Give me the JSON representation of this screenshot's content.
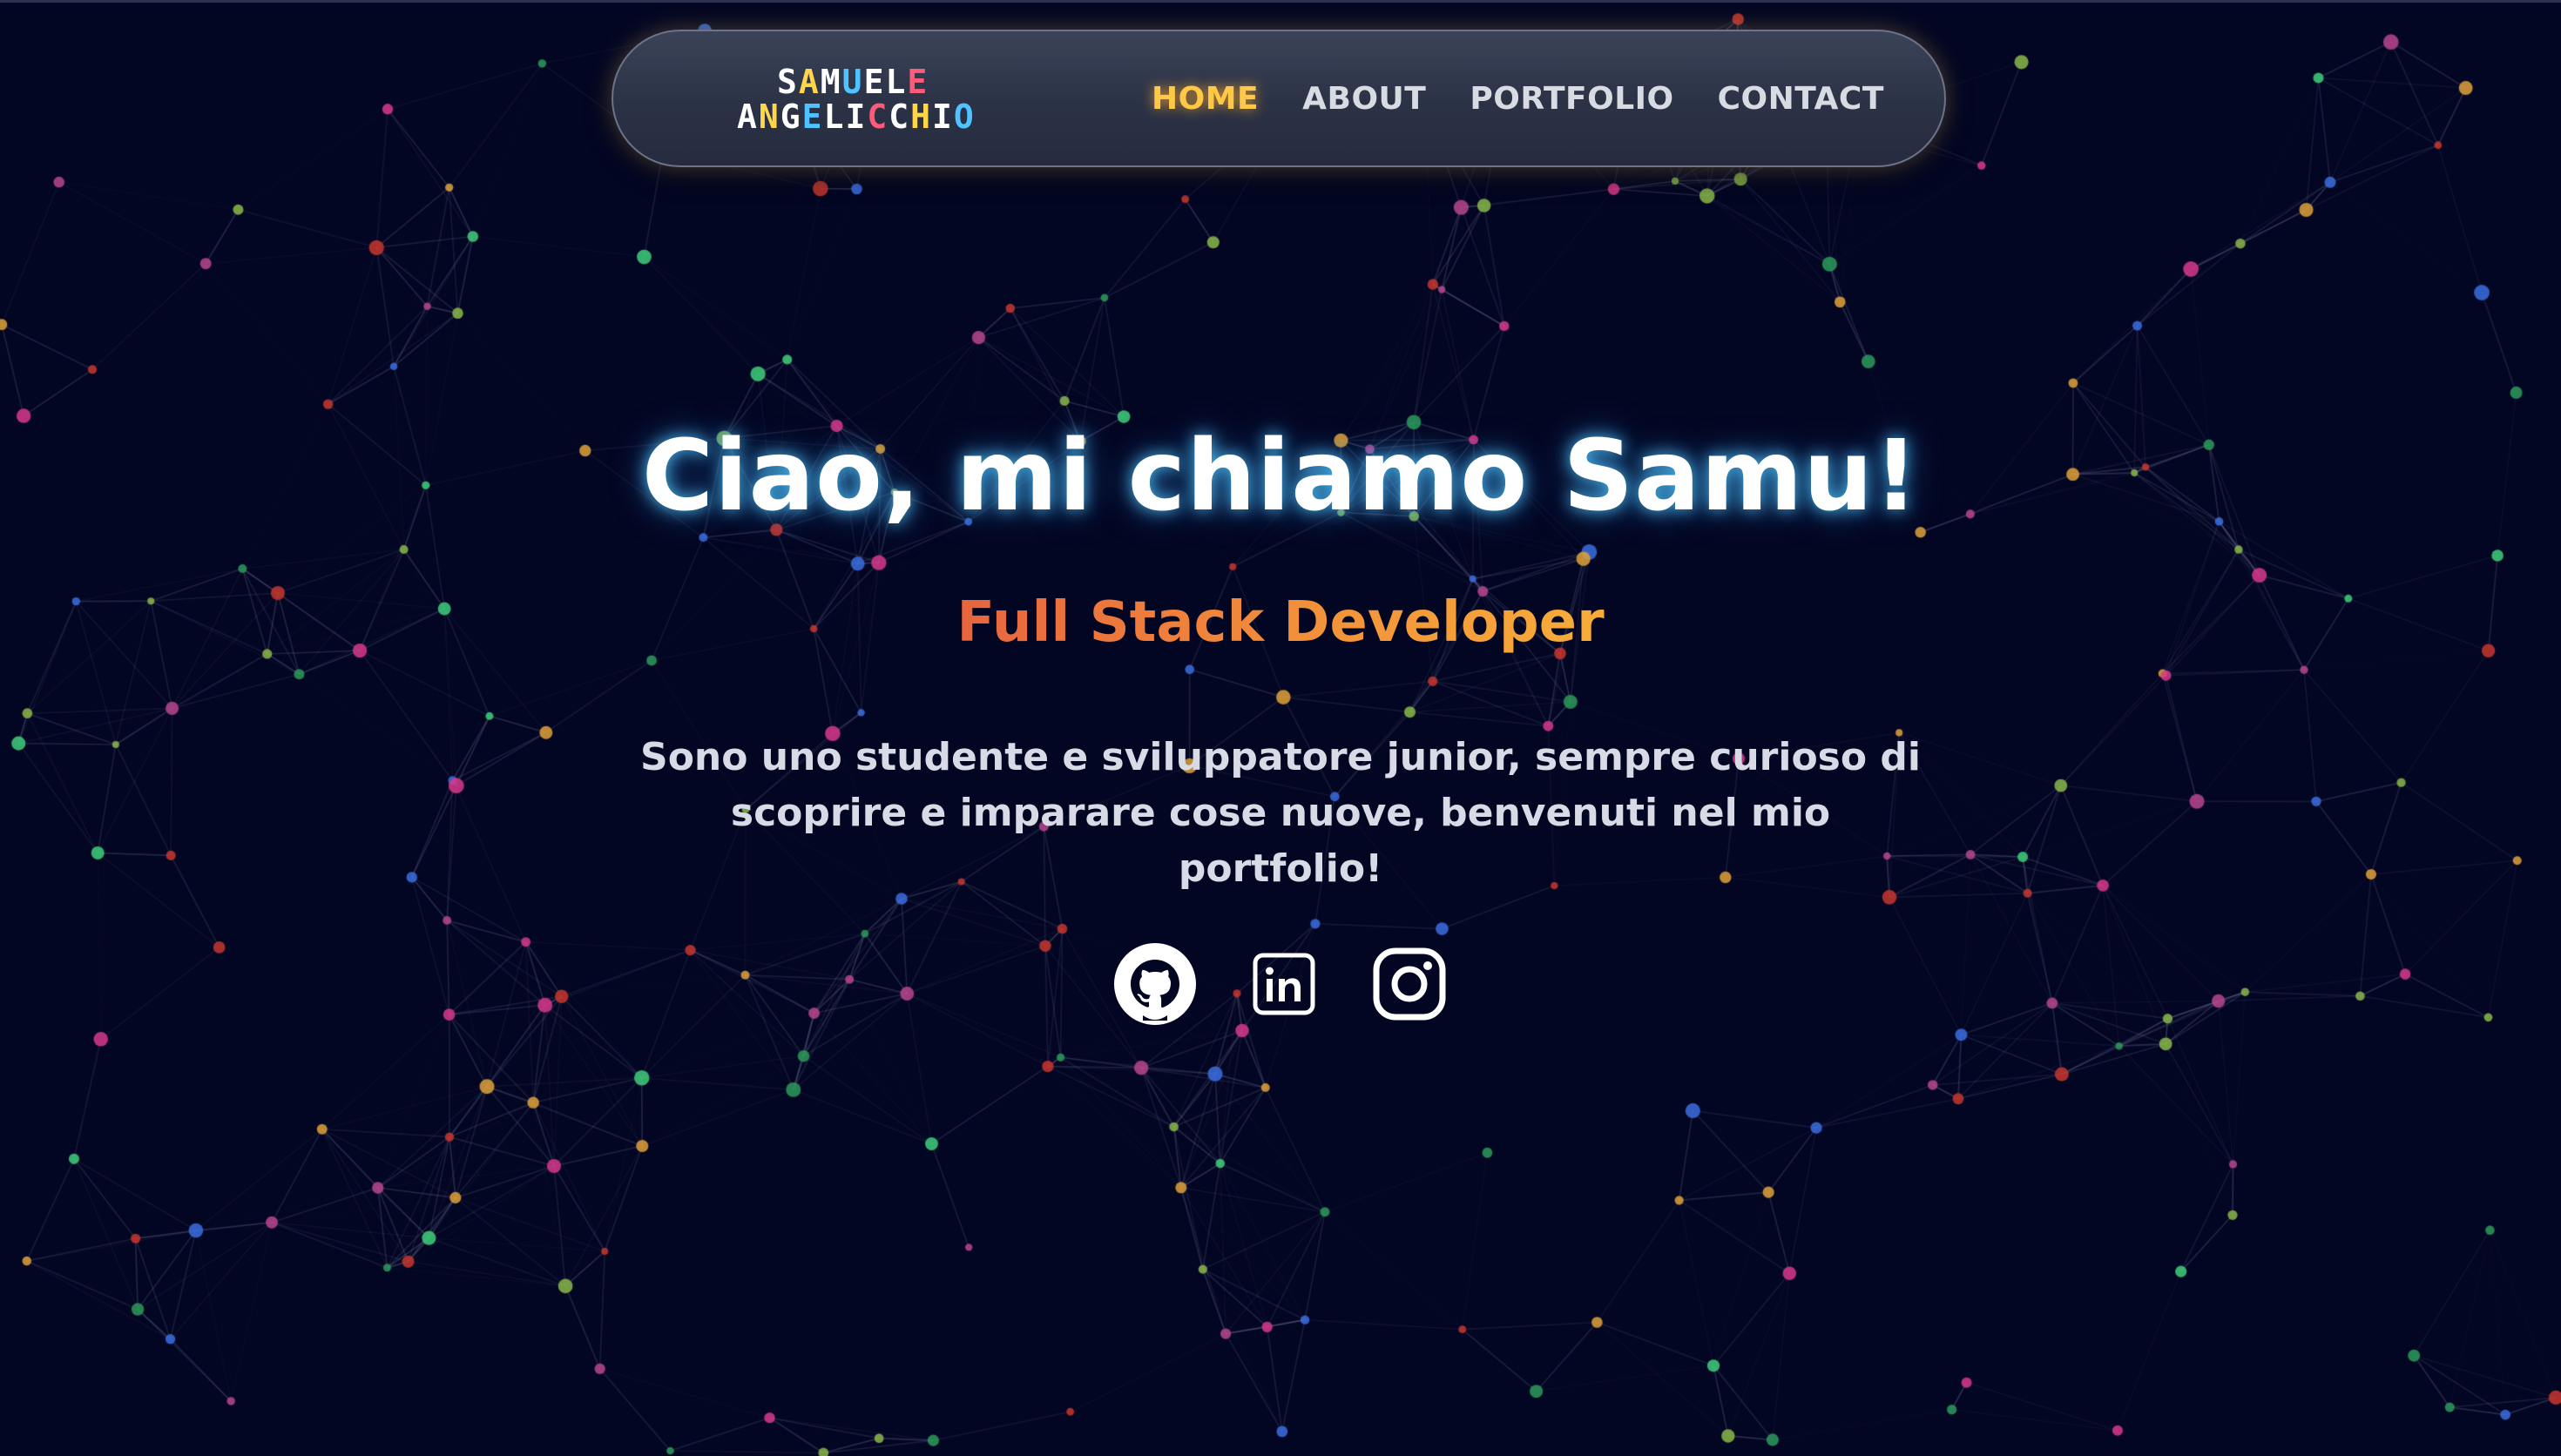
{
  "theme": {
    "background": "#030622",
    "nav_active_color": "#ffc947",
    "nav_text_color": "#d9dbe3",
    "title_glow": "#50c8ff",
    "subtitle_gradient": [
      "#e8643e",
      "#f7ad3a"
    ]
  },
  "navbar": {
    "logo": {
      "line1": "SAMUELE",
      "line2": "ANGELICCHIO"
    },
    "links": [
      {
        "label": "HOME",
        "active": true
      },
      {
        "label": "ABOUT",
        "active": false
      },
      {
        "label": "PORTFOLIO",
        "active": false
      },
      {
        "label": "CONTACT",
        "active": false
      }
    ]
  },
  "hero": {
    "title": "Ciao, mi chiamo Samu!",
    "subtitle": "Full Stack Developer",
    "description": "Sono uno studente e sviluppatore junior, sempre curioso di scoprire e imparare cose nuove, benvenuti nel mio portfolio!"
  },
  "social": [
    {
      "icon": "github-icon"
    },
    {
      "icon": "linkedin-icon"
    },
    {
      "icon": "instagram-icon"
    }
  ]
}
